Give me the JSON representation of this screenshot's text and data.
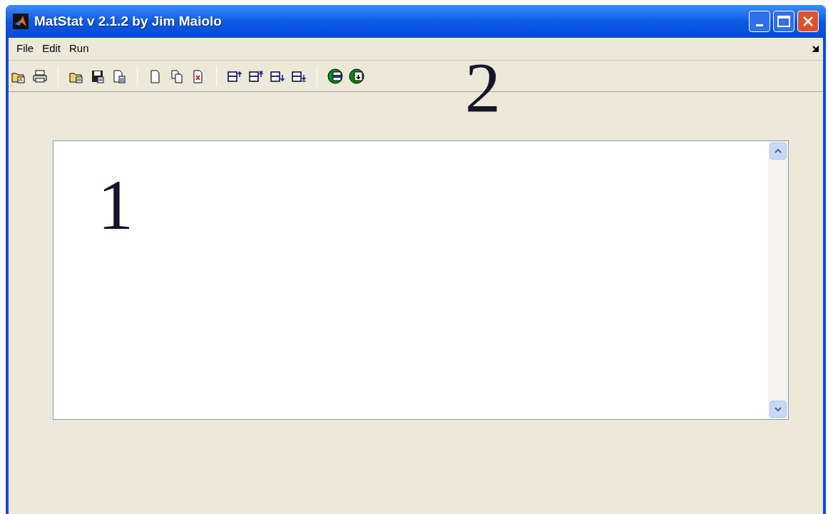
{
  "window": {
    "title": "MatStat v 2.1.2 by Jim Maiolo"
  },
  "menu": [
    {
      "label": "File"
    },
    {
      "label": "Edit"
    },
    {
      "label": "Run"
    }
  ],
  "annotations": [
    {
      "label": "1"
    },
    {
      "label": "2"
    }
  ]
}
